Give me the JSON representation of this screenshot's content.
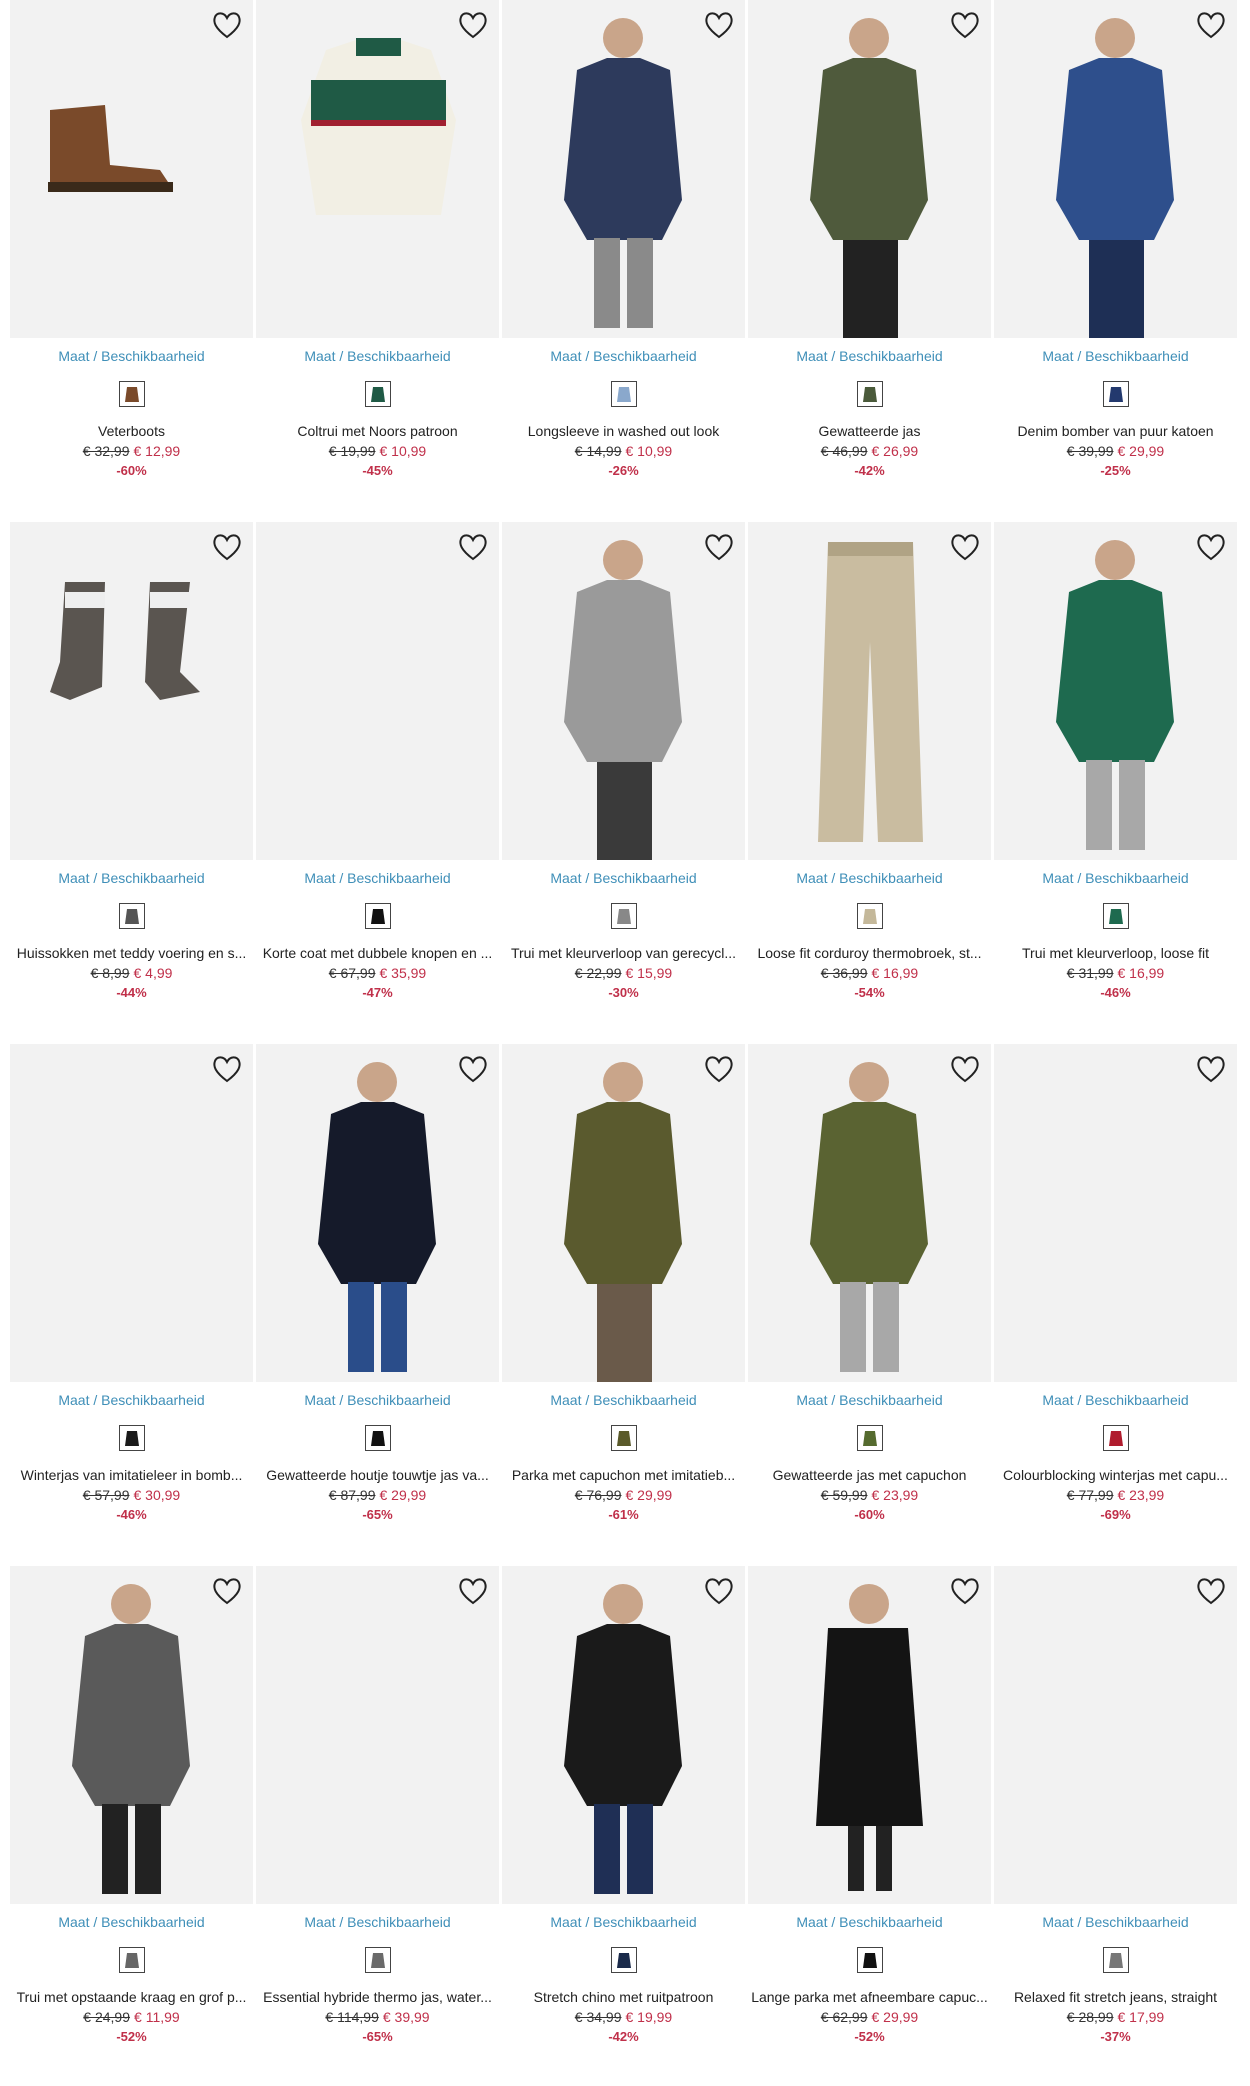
{
  "size_link": {
    "part1": "Maat",
    "separator": " / ",
    "part2": "Beschikbaarheid"
  },
  "favorite_icon": "heart-outline-icon",
  "colors": {
    "link": "#3f8fb8",
    "sale": "#c0304a",
    "image_bg": "#f2f2f2"
  },
  "products": [
    {
      "name": "Veterboots",
      "old_price": "€ 32,99",
      "new_price": "€ 12,99",
      "discount": "-60%",
      "swatch": "#7a4a2a",
      "kind": "boot",
      "main": "#7a4a2a",
      "accent": "#3a2a1a"
    },
    {
      "name": "Coltrui met Noors patroon",
      "old_price": "€ 19,99",
      "new_price": "€ 10,99",
      "discount": "-45%",
      "swatch": "#1f5a45",
      "kind": "sweater",
      "main": "#f2efe4",
      "accent": "#1f5a45"
    },
    {
      "name": "Longsleeve in washed out look",
      "old_price": "€ 14,99",
      "new_price": "€ 10,99",
      "discount": "-26%",
      "swatch": "#8aa8cc",
      "kind": "person",
      "main": "#2d3a5c",
      "accent": "#8a8a8a"
    },
    {
      "name": "Gewatteerde jas",
      "old_price": "€ 46,99",
      "new_price": "€ 26,99",
      "discount": "-42%",
      "swatch": "#4a5a3a",
      "kind": "jacket",
      "main": "#4f5a3c",
      "accent": "#222222"
    },
    {
      "name": "Denim bomber van puur katoen",
      "old_price": "€ 39,99",
      "new_price": "€ 29,99",
      "discount": "-25%",
      "swatch": "#23396e",
      "kind": "jacket",
      "main": "#2e4f8c",
      "accent": "#1e2f55"
    },
    {
      "name": "Huissokken met teddy voering en s...",
      "old_price": "€ 8,99",
      "new_price": "€ 4,99",
      "discount": "-44%",
      "swatch": "#555555",
      "kind": "socks",
      "main": "#5a5550",
      "accent": "#eeeeee"
    },
    {
      "name": "Korte coat met dubbele knopen en ...",
      "old_price": "€ 67,99",
      "new_price": "€ 35,99",
      "discount": "-47%",
      "swatch": "#111111",
      "kind": "empty",
      "main": "#f2f2f2",
      "accent": "#f2f2f2"
    },
    {
      "name": "Trui met kleurverloop van gerecycl...",
      "old_price": "€ 22,99",
      "new_price": "€ 15,99",
      "discount": "-30%",
      "swatch": "#888888",
      "kind": "jacket",
      "main": "#9a9a9a",
      "accent": "#3a3a3a"
    },
    {
      "name": "Loose fit corduroy thermobroek, st...",
      "old_price": "€ 36,99",
      "new_price": "€ 16,99",
      "discount": "-54%",
      "swatch": "#c4b89a",
      "kind": "trousers",
      "main": "#c9bca0",
      "accent": "#b0a385"
    },
    {
      "name": "Trui met kleurverloop, loose fit",
      "old_price": "€ 31,99",
      "new_price": "€ 16,99",
      "discount": "-46%",
      "swatch": "#1e6a4f",
      "kind": "person",
      "main": "#1e6a4f",
      "accent": "#a8a8a8"
    },
    {
      "name": "Winterjas van imitatieleer in bomb...",
      "old_price": "€ 57,99",
      "new_price": "€ 30,99",
      "discount": "-46%",
      "swatch": "#1a1a1a",
      "kind": "empty",
      "main": "#f2f2f2",
      "accent": "#f2f2f2"
    },
    {
      "name": "Gewatteerde houtje touwtje jas va...",
      "old_price": "€ 87,99",
      "new_price": "€ 29,99",
      "discount": "-65%",
      "swatch": "#111111",
      "kind": "person",
      "main": "#151a2a",
      "accent": "#2a4d8a"
    },
    {
      "name": "Parka met capuchon met imitatieb...",
      "old_price": "€ 76,99",
      "new_price": "€ 29,99",
      "discount": "-61%",
      "swatch": "#5a5a2a",
      "kind": "jacket",
      "main": "#5a5a2e",
      "accent": "#6a5a4a"
    },
    {
      "name": "Gewatteerde jas met capuchon",
      "old_price": "€ 59,99",
      "new_price": "€ 23,99",
      "discount": "-60%",
      "swatch": "#556b2f",
      "kind": "person",
      "main": "#5a6332",
      "accent": "#a8a8a8"
    },
    {
      "name": "Colourblocking winterjas met capu...",
      "old_price": "€ 77,99",
      "new_price": "€ 23,99",
      "discount": "-69%",
      "swatch": "#b01c2e",
      "kind": "empty",
      "main": "#f2f2f2",
      "accent": "#f2f2f2"
    },
    {
      "name": "Trui met opstaande kraag en grof p...",
      "old_price": "€ 24,99",
      "new_price": "€ 11,99",
      "discount": "-52%",
      "swatch": "#666666",
      "kind": "person",
      "main": "#5a5a5a",
      "accent": "#222222"
    },
    {
      "name": "Essential hybride thermo jas, water...",
      "old_price": "€ 114,99",
      "new_price": "€ 39,99",
      "discount": "-65%",
      "swatch": "#6a6a6a",
      "kind": "empty",
      "main": "#f2f2f2",
      "accent": "#f2f2f2"
    },
    {
      "name": "Stretch chino met ruitpatroon",
      "old_price": "€ 34,99",
      "new_price": "€ 19,99",
      "discount": "-42%",
      "swatch": "#1a2a4a",
      "kind": "person",
      "main": "#1a1a1a",
      "accent": "#1f2f55"
    },
    {
      "name": "Lange parka met afneembare capuc...",
      "old_price": "€ 62,99",
      "new_price": "€ 29,99",
      "discount": "-52%",
      "swatch": "#111111",
      "kind": "longcoat",
      "main": "#141414",
      "accent": "#222222"
    },
    {
      "name": "Relaxed fit stretch jeans, straight",
      "old_price": "€ 28,99",
      "new_price": "€ 17,99",
      "discount": "-37%",
      "swatch": "#777777",
      "kind": "empty",
      "main": "#f2f2f2",
      "accent": "#f2f2f2"
    }
  ]
}
